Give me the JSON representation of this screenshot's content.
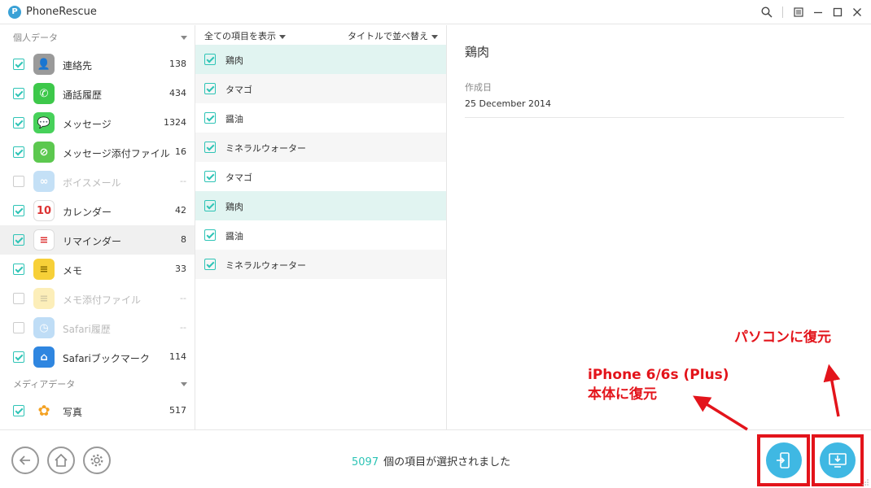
{
  "window": {
    "title": "PhoneRescue",
    "logo_letter": "P"
  },
  "sidebar": {
    "personal_header": "個人データ",
    "media_header": "メディアデータ",
    "items": [
      {
        "label": "連絡先",
        "count": "138",
        "icon": "contacts-icon",
        "checked": true,
        "enabled": true,
        "color": "#9a9a9a"
      },
      {
        "label": "通話履歴",
        "count": "434",
        "icon": "phone-icon",
        "checked": true,
        "enabled": true,
        "color": "#3dc84a"
      },
      {
        "label": "メッセージ",
        "count": "1324",
        "icon": "messages-icon",
        "checked": true,
        "enabled": true,
        "color": "#47d15a"
      },
      {
        "label": "メッセージ添付ファイル",
        "count": "16",
        "icon": "message-attachment-icon",
        "checked": true,
        "enabled": true,
        "color": "#5cc84f"
      },
      {
        "label": "ボイスメール",
        "count": "--",
        "icon": "voicemail-icon",
        "checked": false,
        "enabled": false,
        "color": "#5aa8e8"
      },
      {
        "label": "カレンダー",
        "count": "42",
        "icon": "calendar-icon",
        "checked": true,
        "enabled": true,
        "color": "#ffffff"
      },
      {
        "label": "リマインダー",
        "count": "8",
        "icon": "reminders-icon",
        "checked": true,
        "enabled": true,
        "color": "#ffffff"
      },
      {
        "label": "メモ",
        "count": "33",
        "icon": "notes-icon",
        "checked": true,
        "enabled": true,
        "color": "#f7d038"
      },
      {
        "label": "メモ添付ファイル",
        "count": "--",
        "icon": "notes-attachment-icon",
        "checked": false,
        "enabled": false,
        "color": "#f7d038"
      },
      {
        "label": "Safari履歴",
        "count": "--",
        "icon": "safari-history-icon",
        "checked": false,
        "enabled": false,
        "color": "#4aa0e6"
      },
      {
        "label": "Safariブックマーク",
        "count": "114",
        "icon": "safari-bookmark-icon",
        "checked": true,
        "enabled": true,
        "color": "#2f86e0"
      }
    ],
    "media_items": [
      {
        "label": "写真",
        "count": "517",
        "icon": "photos-icon",
        "checked": true,
        "enabled": true
      }
    ]
  },
  "middle": {
    "show_all_label": "全ての項目を表示",
    "sort_label": "タイトルで並べ替え",
    "items": [
      {
        "label": "鶏肉",
        "style": "sel"
      },
      {
        "label": "タマゴ",
        "style": "alt"
      },
      {
        "label": "醤油",
        "style": ""
      },
      {
        "label": "ミネラルウォーター",
        "style": "alt"
      },
      {
        "label": "タマゴ",
        "style": ""
      },
      {
        "label": "鶏肉",
        "style": "sel"
      },
      {
        "label": "醤油",
        "style": ""
      },
      {
        "label": "ミネラルウォーター",
        "style": "alt"
      }
    ]
  },
  "detail": {
    "title": "鶏肉",
    "created_label": "作成日",
    "created_value": "25 December 2014"
  },
  "bottom": {
    "selected_count": "5097",
    "selected_text": "個の項目が選択されました"
  },
  "annotations": {
    "to_pc": "パソコンに復元",
    "to_device_line1": "iPhone 6/6s (Plus)",
    "to_device_line2": "本体に復元"
  },
  "colors": {
    "accent": "#2ec4b6",
    "restore_button": "#3fb8e3",
    "annotation_red": "#e3141b"
  }
}
